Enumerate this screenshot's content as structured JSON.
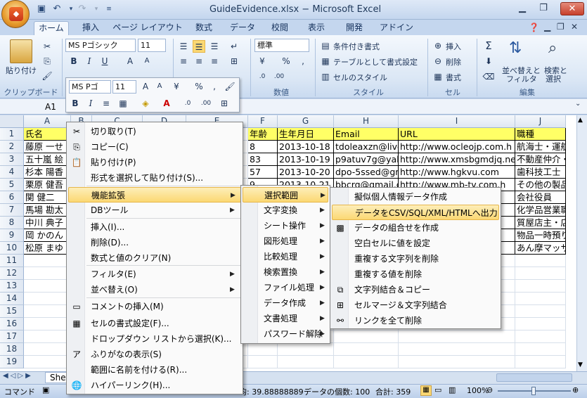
{
  "window": {
    "title": "GuideEvidence.xlsx − Microsoft Excel"
  },
  "ribbon_tabs": [
    "ホーム",
    "挿入",
    "ページ レイアウト",
    "数式",
    "データ",
    "校閲",
    "表示",
    "開発",
    "アドイン"
  ],
  "ribbon": {
    "clipboard": {
      "paste_label": "貼り付け",
      "group_label": "クリップボード"
    },
    "font": {
      "name": "MS Pゴシック",
      "size": "11"
    },
    "number": {
      "format": "標準",
      "group_label": "数値"
    },
    "style": {
      "conditional": "条件付き書式",
      "table": "テーブルとして書式設定",
      "cell_style": "セルのスタイル",
      "group_label": "スタイル"
    },
    "cells": {
      "insert": "挿入",
      "delete": "削除",
      "format": "書式",
      "group_label": "セル"
    },
    "editing": {
      "sort": "並べ替えと",
      "sort2": "フィルタ",
      "find": "検索と",
      "find2": "選択",
      "group_label": "編集"
    }
  },
  "mini_toolbar": {
    "font": "MS Pゴ",
    "size": "11"
  },
  "formula_bar": {
    "name_box": "A1"
  },
  "columns": [
    "A",
    "B",
    "C",
    "D",
    "E",
    "F",
    "G",
    "H",
    "I",
    "J"
  ],
  "rows": [
    {
      "n": "1",
      "A": "氏名",
      "F": "年齢",
      "G": "生年月日",
      "H": "Email",
      "I": "URL",
      "J": "職種"
    },
    {
      "n": "2",
      "A": "藤原 一せ",
      "F": "8",
      "G": "2013-10-18",
      "H": "tdoleaxzn@live",
      "I": "http://www.ocleojp.com.h",
      "J": "航海士・運航"
    },
    {
      "n": "3",
      "A": "五十嵐 絵",
      "F": "83",
      "G": "2013-10-19",
      "H": "p9atuv7g@yah",
      "I": "http://www.xmsbgmdjq.ne",
      "J": "不動産仲介・"
    },
    {
      "n": "4",
      "A": "杉本 陽香",
      "F": "57",
      "G": "2013-10-20",
      "H": "dpo-5ssed@gn",
      "I": "http://www.hgkvu.com",
      "J": "歯科技工士"
    },
    {
      "n": "5",
      "A": "栗原 健吾",
      "F": "9",
      "G": "2013-10-21",
      "H": "bbcrg@gmail.co",
      "I": "http://www.mb-tv.com.h",
      "J": "その他の製品"
    },
    {
      "n": "6",
      "A": "関 健二",
      "F": "",
      "G": "",
      "H": "",
      "I": "ed",
      "J": "会社役員"
    },
    {
      "n": "7",
      "A": "馬場 勘太",
      "F": "",
      "G": "",
      "H": "",
      "I": "",
      "J": "化学品営業職"
    },
    {
      "n": "8",
      "A": "中川 典子",
      "F": "",
      "G": "",
      "H": "",
      "I": "",
      "J": "質屋店主・店"
    },
    {
      "n": "9",
      "A": "岡 かのん",
      "F": "",
      "G": "",
      "H": "",
      "I": "tw",
      "J": "物品一時預り"
    },
    {
      "n": "10",
      "A": "松原 まゆ",
      "F": "",
      "G": "",
      "H": "",
      "I": "o.",
      "J": "あん摩マッサ"
    },
    {
      "n": "11"
    },
    {
      "n": "12"
    },
    {
      "n": "13"
    },
    {
      "n": "14"
    },
    {
      "n": "15"
    },
    {
      "n": "16"
    },
    {
      "n": "17"
    },
    {
      "n": "18"
    },
    {
      "n": "19"
    }
  ],
  "context_menu": {
    "items": [
      {
        "label": "切り取り(T)",
        "icon": "scissors-icon",
        "glyph": "✂"
      },
      {
        "label": "コピー(C)",
        "icon": "copy-icon",
        "glyph": "⎘"
      },
      {
        "label": "貼り付け(P)",
        "icon": "paste-icon",
        "glyph": "📋"
      },
      {
        "label": "形式を選択して貼り付け(S)...",
        "icon": "",
        "glyph": ""
      },
      {
        "label": "機能拡張",
        "icon": "",
        "glyph": "",
        "submenu": true
      },
      {
        "label": "DBツール",
        "icon": "",
        "glyph": "",
        "submenu": true
      },
      {
        "label": "挿入(I)...",
        "icon": "",
        "glyph": ""
      },
      {
        "label": "削除(D)...",
        "icon": "",
        "glyph": ""
      },
      {
        "label": "数式と値のクリア(N)",
        "icon": "",
        "glyph": ""
      },
      {
        "label": "フィルタ(E)",
        "icon": "",
        "glyph": "",
        "submenu": true
      },
      {
        "label": "並べ替え(O)",
        "icon": "",
        "glyph": "",
        "submenu": true
      },
      {
        "label": "コメントの挿入(M)",
        "icon": "comment-icon",
        "glyph": "▭"
      },
      {
        "label": "セルの書式設定(F)...",
        "icon": "format-cells-icon",
        "glyph": "▦"
      },
      {
        "label": "ドロップダウン リストから選択(K)...",
        "icon": "",
        "glyph": ""
      },
      {
        "label": "ふりがなの表示(S)",
        "icon": "furigana-icon",
        "glyph": "ア"
      },
      {
        "label": "範囲に名前を付ける(R)...",
        "icon": "",
        "glyph": ""
      },
      {
        "label": "ハイパーリンク(H)...",
        "icon": "hyperlink-icon",
        "glyph": "🌐"
      }
    ]
  },
  "submenu1": {
    "items": [
      "選択範囲",
      "文字変換",
      "シート操作",
      "図形処理",
      "比較処理",
      "検索置換",
      "ファイル処理",
      "データ作成",
      "文書処理",
      "パスワード解除"
    ]
  },
  "submenu2": {
    "items": [
      {
        "label": "擬似個人情報データ作成",
        "icon": "",
        "glyph": ""
      },
      {
        "label": "データをCSV/SQL/XML/HTMLへ出力",
        "icon": "",
        "glyph": ""
      },
      {
        "label": "データの組合せを作成",
        "icon": "combination-icon",
        "glyph": "▩"
      },
      {
        "label": "空白セルに値を設定",
        "icon": "",
        "glyph": ""
      },
      {
        "label": "重複する文字列を削除",
        "icon": "",
        "glyph": ""
      },
      {
        "label": "重複する値を削除",
        "icon": "",
        "glyph": ""
      },
      {
        "label": "文字列結合＆コピー",
        "icon": "join-copy-icon",
        "glyph": "⧉"
      },
      {
        "label": "セルマージ＆文字列結合",
        "icon": "merge-icon",
        "glyph": "⊞"
      },
      {
        "label": "リンクを全て削除",
        "icon": "unlink-icon",
        "glyph": "⚯"
      }
    ]
  },
  "sheet_tab": "She",
  "status": {
    "mode": "コマンド",
    "average": "均: 39.88888889",
    "count": "データの個数: 100",
    "sum": "合計: 359",
    "zoom": "100%"
  }
}
